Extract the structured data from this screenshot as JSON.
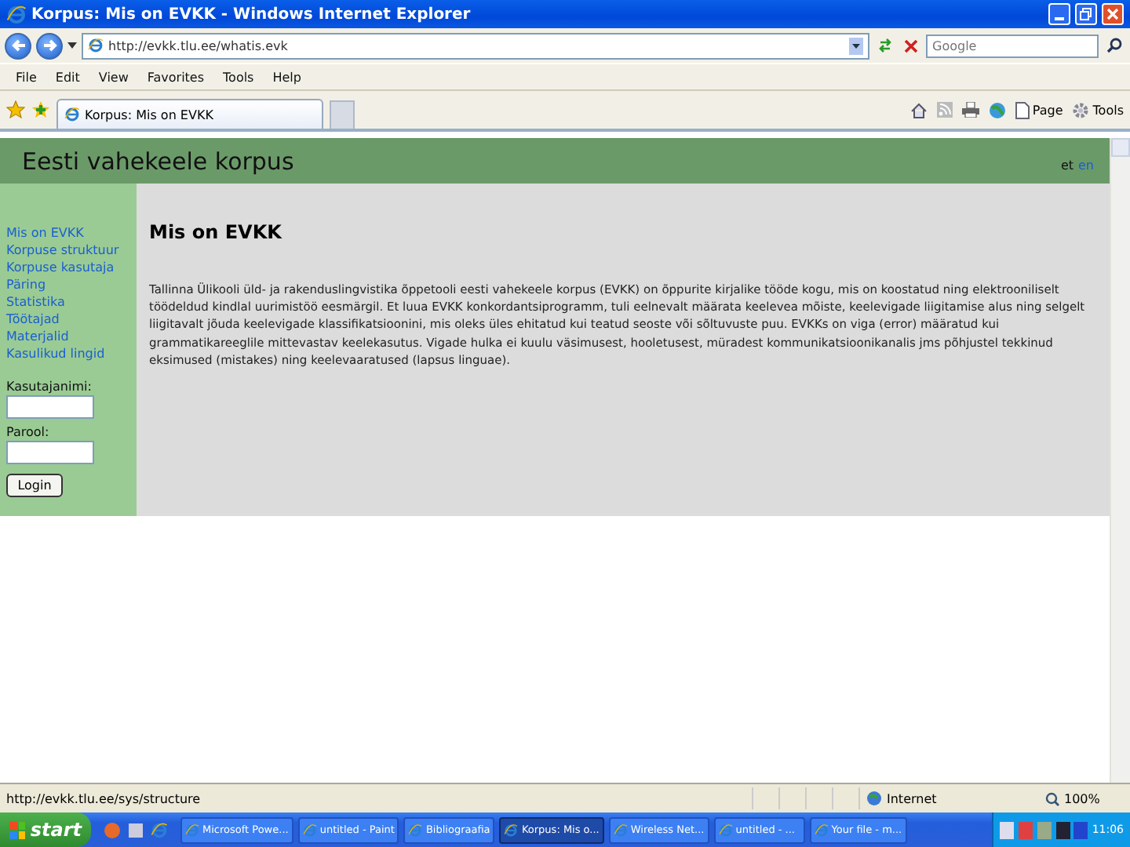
{
  "window": {
    "title": "Korpus: Mis on EVKK - Windows Internet Explorer"
  },
  "nav": {
    "address": "http://evkk.tlu.ee/whatis.evk",
    "search_placeholder": "Google"
  },
  "menu": [
    "File",
    "Edit",
    "View",
    "Favorites",
    "Tools",
    "Help"
  ],
  "tabs": [
    {
      "label": "Korpus: Mis on EVKK",
      "selected": true
    }
  ],
  "command_bar": [
    {
      "kind": "home"
    },
    {
      "kind": "feed"
    },
    {
      "kind": "print"
    },
    {
      "kind": "research"
    },
    {
      "kind": "page",
      "label": "Page"
    },
    {
      "kind": "tools",
      "label": "Tools"
    }
  ],
  "page": {
    "site_title": "Eesti vahekeele korpus",
    "languages": [
      {
        "label": "et",
        "selected": true
      },
      {
        "label": "en",
        "selected": false
      }
    ],
    "nav_links": [
      "Mis on EVKK",
      "Korpuse struktuur",
      "Korpuse kasutaja",
      "Päring",
      "Statistika",
      "Tõötajad",
      "Materjalid",
      "Kasulikud lingid"
    ],
    "login": {
      "username_label": "Kasutajanimi:",
      "password_label": "Parool:",
      "button": "Login"
    },
    "heading": "Mis on EVKK",
    "body": "Tallinna Ülikooli üld- ja rakenduslingvistika õppetooli eesti vahekeele korpus (EVKK) on õppurite kirjalike tööde kogu, mis on koostatud ning elektrooniliselt töödeldud kindlal uurimistöö eesmärgil. Et luua EVKK konkordantsiprogramm, tuli eelnevalt määrata keelevea mõiste, keelevigade liigitamise alus ning selgelt liigitavalt jõuda keelevigade klassifikatsioonini, mis oleks üles ehitatud kui teatud seoste või sõltuvuste puu. EVKKs on viga (error) määratud kui grammatikareeglile mittevastav keelekasutus. Vigade hulka ei kuulu väsimusest, hooletusest, müradest kommunikatsioonikanalis jms põhjustel tekkinud eksimused (mistakes) ning keelevaaratused (lapsus linguae)."
  },
  "status_bar": {
    "url": "http://evkk.tlu.ee/sys/structure",
    "zone": "Internet",
    "zoom": "100%"
  },
  "taskbar": {
    "start": "start",
    "tasks": [
      {
        "label": "Microsoft Powe...",
        "selected": false
      },
      {
        "label": "untitled - Paint",
        "selected": false
      },
      {
        "label": "Bibliograafia",
        "selected": false
      },
      {
        "label": "Korpus: Mis o...",
        "selected": true
      },
      {
        "label": "Wireless Net...",
        "selected": false
      },
      {
        "label": "untitled - ...",
        "selected": false
      },
      {
        "label": "Your file - m...",
        "selected": false
      }
    ],
    "clock": "11:06"
  }
}
